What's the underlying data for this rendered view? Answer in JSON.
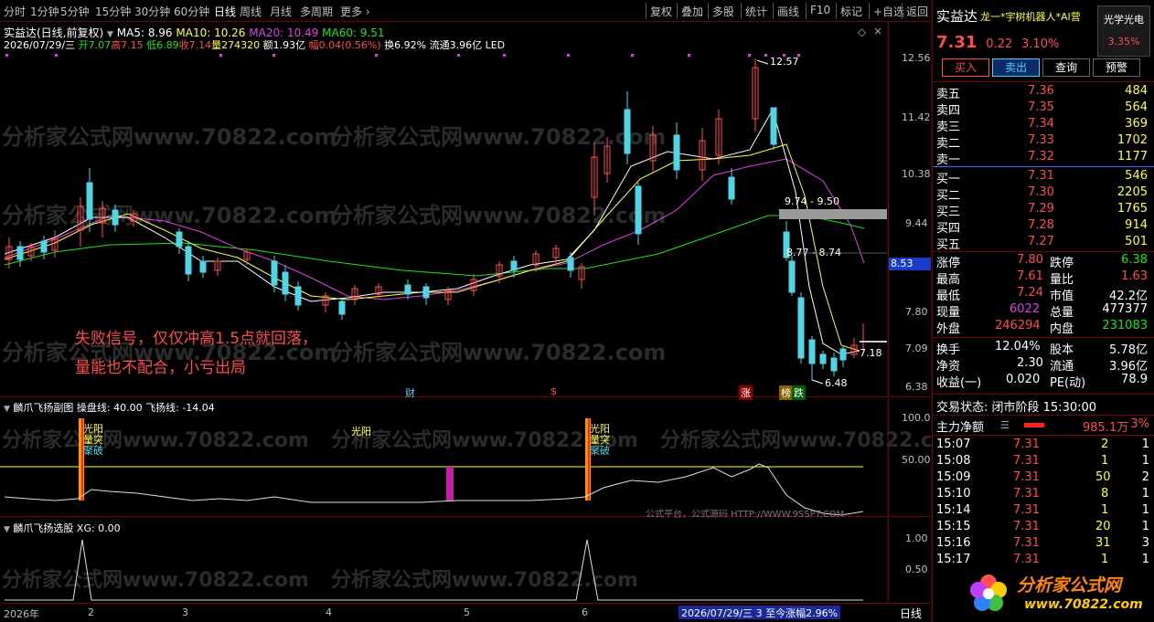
{
  "toolbar": {
    "periods": [
      "分时",
      "1分钟",
      "5分钟",
      "15分钟",
      "30分钟",
      "60分钟",
      "日线",
      "周线",
      "月线",
      "多周期",
      "更多"
    ],
    "active_period": "日线",
    "buttons": [
      "复权",
      "叠加",
      "多股",
      "统计",
      "画线",
      "F10",
      "标记",
      "+自选",
      "返回"
    ]
  },
  "stock_header": {
    "title": "实益达(日线,前复权)",
    "ma5": "MA5: 8.96",
    "ma10": "MA10: 10.26",
    "ma20": "MA20: 10.49",
    "ma60": "MA60: 9.51",
    "info_line_date": "2026/07/29/三",
    "info_open": "开7.07",
    "info_high": "高7.15",
    "info_low": "低6.89",
    "info_close": "收7.14",
    "info_vol": "量274320",
    "info_amount": "额1.93亿",
    "info_range": "幅0.04(0.56%)",
    "info_turnover": "换6.92%",
    "info_float": "流通3.96亿",
    "info_led": "LED"
  },
  "price_axis": [
    "12.56",
    "11.42",
    "10.38",
    "9.44",
    "8.53",
    "7.80",
    "7.09",
    "6.38"
  ],
  "price_labels": {
    "high_mark": "12.57",
    "low_mark": "6.48",
    "gap1": "9.74 - 9.50",
    "gap2": "8.77 - 8.74",
    "last": "7.18",
    "badge_cai": "财",
    "badge_s": "$",
    "badge_zhang": "涨",
    "badge_bang": "榜",
    "badge_die": "跌"
  },
  "annotation": {
    "line1": "失败信号，仅仅冲高1.5点就回落，",
    "line2": "量能也不配合，小亏出局"
  },
  "watermark": "分析家公式网www.70822.com",
  "sub1": {
    "title": "麟爪飞扬副图",
    "param1": "操盘线: 40.00",
    "param2": "飞扬线: -14.04",
    "axis": [
      "100.0",
      "50.00"
    ],
    "signal_label1": "光阳",
    "signal_label2": "量突",
    "signal_label3": "聚破",
    "mid_label": "光阳",
    "footer_note": "公式平台，公式源码 HTTP://WWW.9SSPT.COM"
  },
  "sub2": {
    "title": "麟爪飞扬选股",
    "param": "XG: 0.00",
    "axis": [
      "1.00",
      "0.50"
    ]
  },
  "datebar": {
    "year": "2026年",
    "months": [
      "2",
      "3",
      "4",
      "5",
      "6"
    ],
    "status": "2026/07/29/三 3 至今涨幅2.96%",
    "period": "日线"
  },
  "quote": {
    "name": "实益达",
    "tags": "龙一*宇树机器人*AI营",
    "sector_btn": "光学光电",
    "sector_pct": "3.35%",
    "price": "7.31",
    "change": "0.22",
    "pct": "3.10%",
    "buy_btn": "买入",
    "sell_btn": "卖出",
    "query_btn": "查询",
    "alert_btn": "预警",
    "asks": [
      {
        "label": "卖五",
        "price": "7.36",
        "vol": "484"
      },
      {
        "label": "卖四",
        "price": "7.35",
        "vol": "564"
      },
      {
        "label": "卖三",
        "price": "7.34",
        "vol": "369"
      },
      {
        "label": "卖二",
        "price": "7.33",
        "vol": "1702"
      },
      {
        "label": "卖一",
        "price": "7.32",
        "vol": "1177"
      }
    ],
    "bids": [
      {
        "label": "买一",
        "price": "7.31",
        "vol": "546"
      },
      {
        "label": "买二",
        "price": "7.30",
        "vol": "2205"
      },
      {
        "label": "买三",
        "price": "7.29",
        "vol": "1765"
      },
      {
        "label": "买四",
        "price": "7.28",
        "vol": "914"
      },
      {
        "label": "买五",
        "price": "7.27",
        "vol": "501"
      }
    ],
    "stats": [
      {
        "l1": "涨停",
        "v1": "7.80",
        "l2": "跌停",
        "v2": "6.38"
      },
      {
        "l1": "最高",
        "v1": "7.61",
        "l2": "量比",
        "v2": "1.63"
      },
      {
        "l1": "最低",
        "v1": "7.24",
        "l2": "市值",
        "v2": "42.2亿"
      },
      {
        "l1": "现量",
        "v1": "6022",
        "l2": "总量",
        "v2": "477377"
      },
      {
        "l1": "外盘",
        "v1": "246294",
        "l2": "内盘",
        "v2": "231083"
      }
    ],
    "stats2": [
      {
        "l1": "换手",
        "v1": "12.04%",
        "l2": "股本",
        "v2": "5.78亿"
      },
      {
        "l1": "净资",
        "v1": "2.30",
        "l2": "流通",
        "v2": "3.96亿"
      },
      {
        "l1": "收益(一)",
        "v1": "0.020",
        "l2": "PE(动)",
        "v2": "78.9"
      }
    ],
    "trade_status": "交易状态: 闭市阶段 15:30:00",
    "capital_label": "主力净额",
    "capital_value": "985.1万",
    "capital_pct": "3%",
    "ticks": [
      {
        "t": "15:07",
        "p": "7.31",
        "v": "2",
        "n": "1"
      },
      {
        "t": "15:08",
        "p": "7.31",
        "v": "1",
        "n": "1"
      },
      {
        "t": "15:09",
        "p": "7.31",
        "v": "50",
        "n": "2"
      },
      {
        "t": "15:10",
        "p": "7.31",
        "v": "8",
        "n": "1"
      },
      {
        "t": "15:14",
        "p": "7.31",
        "v": "1",
        "n": "1"
      },
      {
        "t": "15:15",
        "p": "7.31",
        "v": "20",
        "n": "1"
      },
      {
        "t": "15:16",
        "p": "7.31",
        "v": "31",
        "n": "3"
      },
      {
        "t": "15:17",
        "p": "7.31",
        "v": "1",
        "n": "1"
      }
    ],
    "logo_text": "分析家公式网",
    "logo_url": "www.70822.com"
  },
  "colors": {
    "up": "#ff4c4c",
    "down": "#4cd6e6",
    "ma5": "#ffffff",
    "ma10": "#ffff40",
    "ma20": "#e040e0",
    "ma60": "#19e619"
  }
}
